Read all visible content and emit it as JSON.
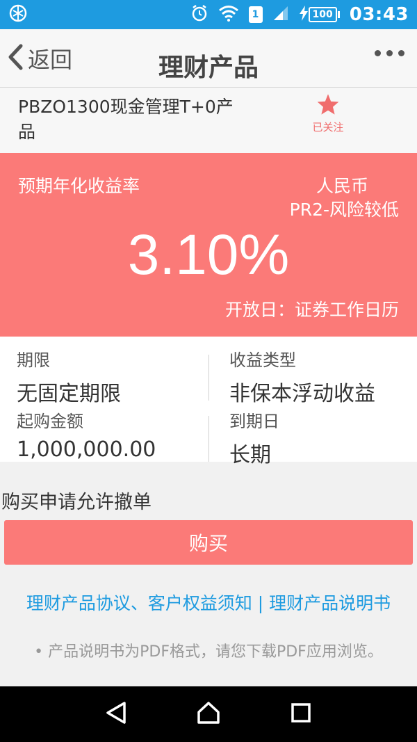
{
  "status_bar": {
    "sim_slot": "1",
    "battery": "100",
    "time": "03:43"
  },
  "nav": {
    "back_label": "返回",
    "title": "理财产品"
  },
  "product": {
    "name": "PBZO1300现金管理T+0产品",
    "follow_label": "已关注"
  },
  "yield_card": {
    "label": "预期年化收益率",
    "currency": "人民币",
    "risk_level": "PR2-风险较低",
    "rate": "3.10%",
    "open_day": "开放日：证券工作日历"
  },
  "details": {
    "term_label": "期限",
    "term_value": "无固定期限",
    "income_type_label": "收益类型",
    "income_type_value": "非保本浮动收益",
    "min_amount_label": "起购金额",
    "min_amount_value": "1,000,000.00",
    "maturity_label": "到期日",
    "maturity_value": "长期"
  },
  "actions": {
    "cancel_note": "购买申请允许撤单",
    "buy_label": "购买",
    "link_agreement": "理财产品协议、客户权益须知",
    "link_separator": " | ",
    "link_prospectus": "理财产品说明书",
    "pdf_note": "• 产品说明书为PDF格式，请您下载PDF应用浏览。"
  },
  "colors": {
    "status_blue": "#1e9be0",
    "accent_red": "#fb7a78",
    "link_blue": "#1e9be0"
  }
}
